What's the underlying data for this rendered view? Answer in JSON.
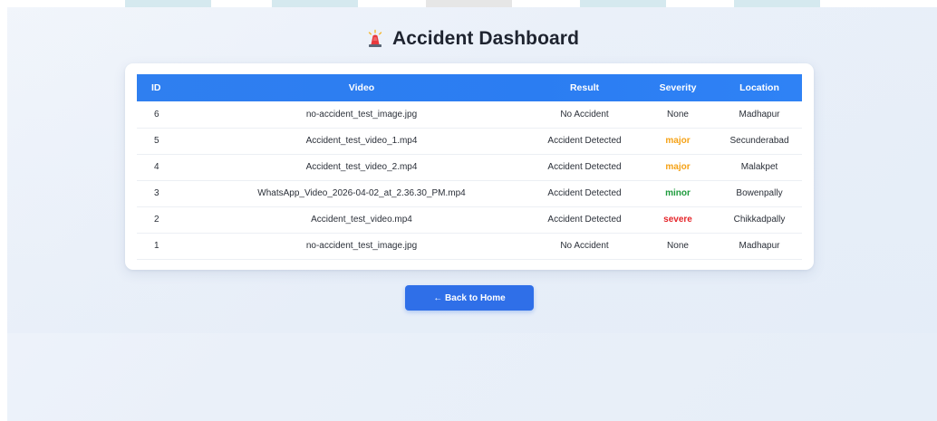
{
  "header": {
    "title": "Accident Dashboard",
    "icon": "siren-icon"
  },
  "table": {
    "columns": [
      "ID",
      "Video",
      "Result",
      "Severity",
      "Location"
    ],
    "rows": [
      {
        "id": "6",
        "video": "no-accident_test_image.jpg",
        "result": "No Accident",
        "severity": "None",
        "location": "Madhapur"
      },
      {
        "id": "5",
        "video": "Accident_test_video_1.mp4",
        "result": "Accident Detected",
        "severity": "major",
        "location": "Secunderabad"
      },
      {
        "id": "4",
        "video": "Accident_test_video_2.mp4",
        "result": "Accident Detected",
        "severity": "major",
        "location": "Malakpet"
      },
      {
        "id": "3",
        "video": "WhatsApp_Video_2026-04-02_at_2.36.30_PM.mp4",
        "result": "Accident Detected",
        "severity": "minor",
        "location": "Bowenpally"
      },
      {
        "id": "2",
        "video": "Accident_test_video.mp4",
        "result": "Accident Detected",
        "severity": "severe",
        "location": "Chikkadpally"
      },
      {
        "id": "1",
        "video": "no-accident_test_image.jpg",
        "result": "No Accident",
        "severity": "None",
        "location": "Madhapur"
      }
    ]
  },
  "actions": {
    "back_label": "← Back to Home"
  },
  "colors": {
    "header_bg": "#2f7ff0",
    "button_bg": "#2f6fe8",
    "major": "#f5a216",
    "minor": "#1e9b3d",
    "severe": "#e5252a"
  }
}
